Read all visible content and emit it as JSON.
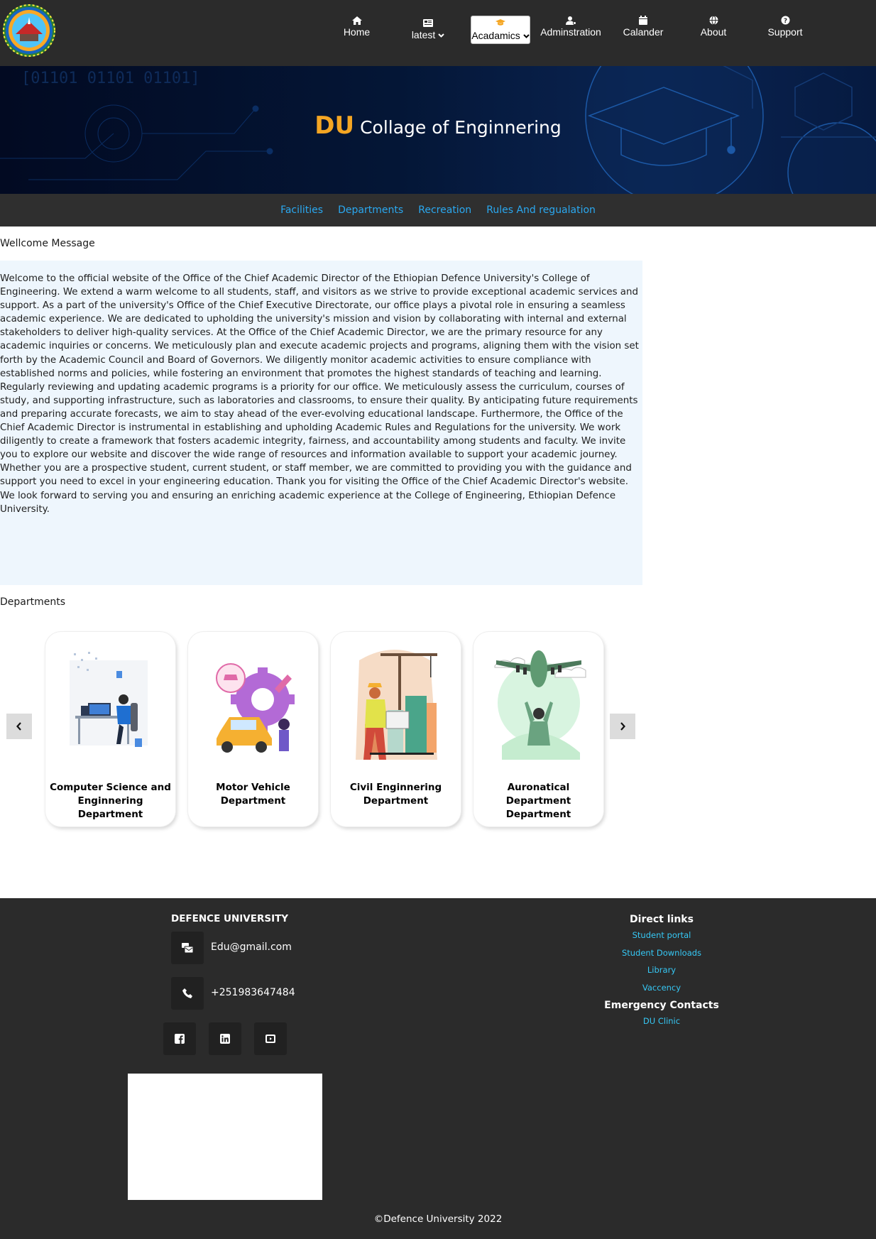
{
  "navbar": {
    "items": [
      {
        "label": "Home",
        "icon": "home-icon"
      },
      {
        "label": "latest",
        "icon": "newspaper-icon",
        "has_dropdown": true
      },
      {
        "label": "Acadamics",
        "icon": "graduation-cap-icon",
        "has_dropdown": true,
        "selected": true
      },
      {
        "label": "Adminstration",
        "icon": "user-gear-icon"
      },
      {
        "label": "Calander",
        "icon": "calendar-icon"
      },
      {
        "label": "About",
        "icon": "globe-icon"
      },
      {
        "label": "Support",
        "icon": "question-circle-icon"
      }
    ],
    "accent_color": "#f5a623"
  },
  "hero": {
    "title_prefix": "DU",
    "title_rest": "Collage of Enginnering",
    "binary_text": "[01101 01101 01101]"
  },
  "subnav": {
    "links": [
      "Facilities",
      "Departments",
      "Recreation",
      "Rules And regualation"
    ],
    "link_color": "#2aa8f0"
  },
  "welcome": {
    "heading": "Wellcome Message",
    "body": "Welcome to the official website of the Office of the Chief Academic Director of the Ethiopian Defence University's College of Engineering. We extend a warm welcome to all students, staff, and visitors as we strive to provide exceptional academic services and support. As a part of the university's Office of the Chief Executive Directorate, our office plays a pivotal role in ensuring a seamless academic experience. We are dedicated to upholding the university's mission and vision by collaborating with internal and external stakeholders to deliver high-quality services. At the Office of the Chief Academic Director, we are the primary resource for any academic inquiries or concerns. We meticulously plan and execute academic projects and programs, aligning them with the vision set forth by the Academic Council and Board of Governors. We diligently monitor academic activities to ensure compliance with established norms and policies, while fostering an environment that promotes the highest standards of teaching and learning. Regularly reviewing and updating academic programs is a priority for our office. We meticulously assess the curriculum, courses of study, and supporting infrastructure, such as laboratories and classrooms, to ensure their quality. By anticipating future requirements and preparing accurate forecasts, we aim to stay ahead of the ever-evolving educational landscape. Furthermore, the Office of the Chief Academic Director is instrumental in establishing and upholding Academic Rules and Regulations for the university. We work diligently to create a framework that fosters academic integrity, fairness, and accountability among students and faculty. We invite you to explore our website and discover the wide range of resources and information available to support your academic journey. Whether you are a prospective student, current student, or staff member, we are committed to providing you with the guidance and support you need to excel in your engineering education. Thank you for visiting the Office of the Chief Academic Director's website. We look forward to serving you and ensuring an enriching academic experience at the College of Engineering, Ethiopian Defence University."
  },
  "departments": {
    "heading": "Departments",
    "cards": [
      {
        "title": "Computer Science and Enginnering Department"
      },
      {
        "title": "Motor Vehicle Department"
      },
      {
        "title": "Civil Enginnering Department"
      },
      {
        "title": "Auronatical Department Department"
      }
    ]
  },
  "footer": {
    "brand": "DEFENCE UNIVERSITY",
    "email": "Edu@gmail.com",
    "phone": "+251983647484",
    "social": [
      "facebook-icon",
      "linkedin-icon",
      "youtube-icon"
    ],
    "direct_links_heading": "Direct links",
    "direct_links": [
      "Student portal",
      "Student Downloads",
      "Library",
      "Vaccency"
    ],
    "emergency_heading": "Emergency Contacts",
    "emergency_links": [
      "DU Clinic"
    ],
    "copyright": "©Defence University 2022",
    "link_color": "#36c8f5"
  }
}
